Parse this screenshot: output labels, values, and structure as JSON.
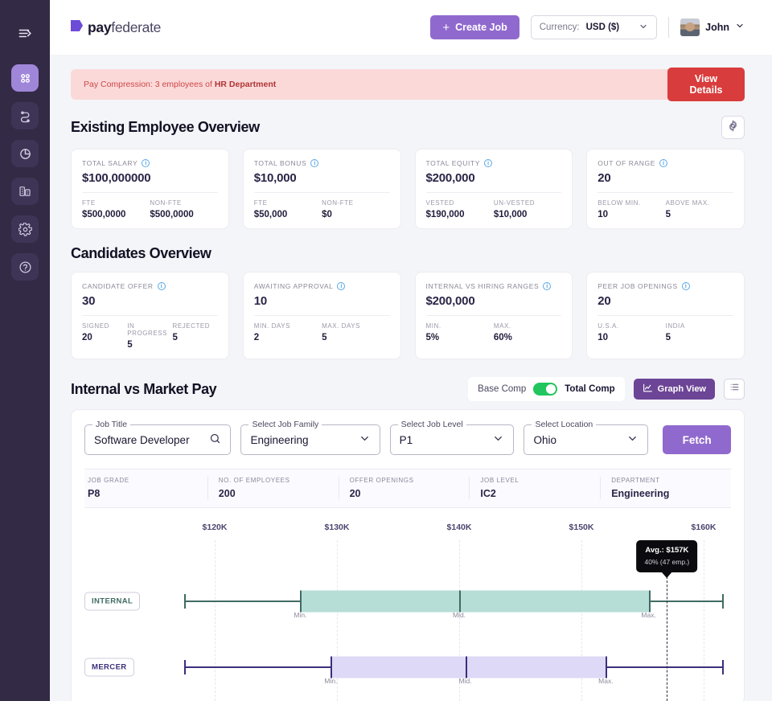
{
  "sidebar": {
    "toggle_icon": "menu-collapse-icon",
    "items": [
      {
        "name": "dashboard",
        "icon": "grid-dots-icon",
        "active": true
      },
      {
        "name": "workflow",
        "icon": "workflow-arrows-icon",
        "active": false
      },
      {
        "name": "analytics",
        "icon": "pie-chart-icon",
        "active": false
      },
      {
        "name": "organization",
        "icon": "building-icon",
        "active": false
      },
      {
        "name": "settings",
        "icon": "gear-icon",
        "active": false
      },
      {
        "name": "help",
        "icon": "question-circle-icon",
        "active": false
      }
    ]
  },
  "topbar": {
    "logo_bold": "pay",
    "logo_light": "federate",
    "create_job_label": "Create Job",
    "create_job_plus": "+",
    "currency_prefix": "Currency:",
    "currency_value": "USD ($)",
    "user_name": "John"
  },
  "alert": {
    "prefix": "Pay Compression: 3 employees of ",
    "strong": "HR Department",
    "button_line1": "View",
    "button_line2": "Details",
    "bg_color": "#fbd9d9",
    "button_color": "#d93c3c"
  },
  "employee_overview": {
    "title": "Existing Employee Overview",
    "gear_icon": "gear-icon",
    "cards": [
      {
        "label": "TOTAL SALARY",
        "value": "$100,000000",
        "sub": [
          {
            "label": "FTE",
            "value": "$500,0000"
          },
          {
            "label": "NON-FTE",
            "value": "$500,0000"
          }
        ]
      },
      {
        "label": "TOTAL BONUS",
        "value": "$10,000",
        "sub": [
          {
            "label": "FTE",
            "value": "$50,000"
          },
          {
            "label": "NON-FTE",
            "value": "$0"
          }
        ]
      },
      {
        "label": "TOTAL EQUITY",
        "value": "$200,000",
        "sub": [
          {
            "label": "VESTED",
            "value": "$190,000"
          },
          {
            "label": "UN-VESTED",
            "value": "$10,000"
          }
        ]
      },
      {
        "label": "OUT OF RANGE",
        "value": "20",
        "sub": [
          {
            "label": "BELOW MIN.",
            "value": "10"
          },
          {
            "label": "ABOVE MAX.",
            "value": "5"
          }
        ]
      }
    ]
  },
  "candidates_overview": {
    "title": "Candidates Overview",
    "cards": [
      {
        "label": "CANDIDATE OFFER",
        "value": "30",
        "sub": [
          {
            "label": "SIGNED",
            "value": "20"
          },
          {
            "label": "IN PROGRESS",
            "value": "5"
          },
          {
            "label": "REJECTED",
            "value": "5"
          }
        ]
      },
      {
        "label": "AWAITING APPROVAL",
        "value": "10",
        "sub": [
          {
            "label": "MIN. DAYS",
            "value": "2"
          },
          {
            "label": "MAX. DAYS",
            "value": "5"
          }
        ]
      },
      {
        "label": "INTERNAL VS HIRING RANGES",
        "value": "$200,000",
        "sub": [
          {
            "label": "MIN.",
            "value": "5%"
          },
          {
            "label": "MAX.",
            "value": "60%"
          }
        ]
      },
      {
        "label": "PEER JOB OPENINGS",
        "value": "20",
        "sub": [
          {
            "label": "U.S.A.",
            "value": "10"
          },
          {
            "label": "INDIA",
            "value": "5"
          }
        ]
      }
    ]
  },
  "internal_vs_market": {
    "title": "Internal vs Market Pay",
    "toggle_left_label": "Base Comp",
    "toggle_right_label": "Total Comp",
    "toggle_on": true,
    "toggle_color": "#22c55e",
    "graph_view_label": "Graph View",
    "graph_view_icon": "line-chart-icon",
    "list_view_icon": "list-view-icon",
    "filters": [
      {
        "legend": "Job Title",
        "value": "Software Developer",
        "control": "search-input",
        "icon": "search-icon"
      },
      {
        "legend": "Select Job Family",
        "value": "Engineering",
        "control": "select",
        "icon": "chevron-down-icon"
      },
      {
        "legend": "Select Job Level",
        "value": "P1",
        "control": "select",
        "icon": "chevron-down-icon"
      },
      {
        "legend": "Select Location",
        "value": "Ohio",
        "control": "select",
        "icon": "chevron-down-icon"
      }
    ],
    "fetch_label": "Fetch",
    "info_strip": [
      {
        "label": "JOB GRADE",
        "value": "P8"
      },
      {
        "label": "NO. OF EMPLOYEES",
        "value": "200"
      },
      {
        "label": "OFFER OPENINGS",
        "value": "20"
      },
      {
        "label": "JOB LEVEL",
        "value": "IC2"
      },
      {
        "label": "DEPARTMENT",
        "value": "Engineering"
      }
    ]
  },
  "chart_data": {
    "type": "bar",
    "title": "Internal vs Market Pay",
    "xlabel": "",
    "ylabel": "",
    "xlim": [
      115000,
      165000
    ],
    "grid": true,
    "tick_labels": [
      "$120K",
      "$130K",
      "$140K",
      "$150K",
      "$160K"
    ],
    "tick_values": [
      120000,
      130000,
      140000,
      150000,
      160000
    ],
    "point_labels": {
      "min": "Min.",
      "mid": "Mid.",
      "max": "Max."
    },
    "annotation": {
      "avg_label": "Avg.: $157K",
      "detail_label": "40% (47 emp.)",
      "avg_value": 157000,
      "percent": 40,
      "employees": 47
    },
    "series": [
      {
        "name": "INTERNAL",
        "color": "#b6ddd6",
        "line_color": "#3f6b62",
        "whisker_min": 117500,
        "box_min": 127000,
        "box_mid": 140000,
        "box_max": 155500,
        "whisker_max": 161500
      },
      {
        "name": "MERCER",
        "color": "#ddd9f6",
        "line_color": "#3c2f7a",
        "whisker_min": 117500,
        "box_min": 129500,
        "box_mid": 140500,
        "box_max": 152000,
        "whisker_max": 161500
      }
    ]
  }
}
